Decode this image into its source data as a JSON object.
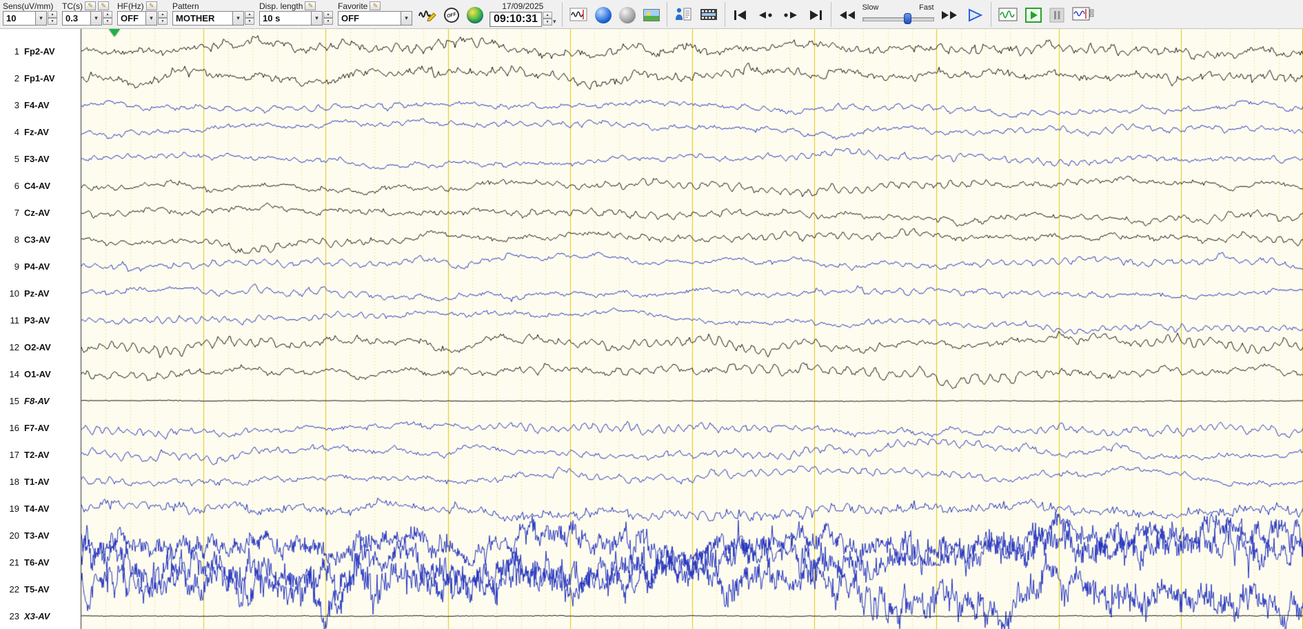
{
  "colors": {
    "trace_black": "#161616",
    "trace_blue": "#2433c0",
    "bg_paper": "#fdfcee",
    "grid_major": "#e3c417",
    "grid_minor": "#eedd8e",
    "marker_green": "#21b24b",
    "accent_blue": "#2f5fd7"
  },
  "icons": {
    "pencil": "✎",
    "caret": "▾",
    "spin_up": "▲",
    "spin_down": "▼"
  },
  "toolbar": {
    "sens": {
      "label": "Sens(uV/mm)",
      "value": "10"
    },
    "tc": {
      "label": "TC(s)",
      "value": "0.3"
    },
    "hf": {
      "label": "HF(Hz)",
      "value": "OFF"
    },
    "pattern": {
      "label": "Pattern",
      "value": "MOTHER"
    },
    "disp_length": {
      "label": "Disp. length",
      "value": "10 s"
    },
    "favorite": {
      "label": "Favorite",
      "value": "OFF"
    },
    "off_stamp": "OFF",
    "date": "17/09/2025",
    "time": "09:10:31",
    "speed": {
      "slow": "Slow",
      "fast": "Fast"
    }
  },
  "display": {
    "seconds": 10
  },
  "channels": [
    {
      "num": "1",
      "label": "Fp2-AV",
      "color": "black",
      "profile": "frontal",
      "italic": false
    },
    {
      "num": "2",
      "label": "Fp1-AV",
      "color": "black",
      "profile": "frontal",
      "italic": false
    },
    {
      "num": "3",
      "label": "F4-AV",
      "color": "blue",
      "profile": "bluemid",
      "italic": false
    },
    {
      "num": "4",
      "label": "Fz-AV",
      "color": "blue",
      "profile": "bluemid",
      "italic": false
    },
    {
      "num": "5",
      "label": "F3-AV",
      "color": "blue",
      "profile": "bluemid",
      "italic": false
    },
    {
      "num": "6",
      "label": "C4-AV",
      "color": "black",
      "profile": "central",
      "italic": false
    },
    {
      "num": "7",
      "label": "Cz-AV",
      "color": "black",
      "profile": "central",
      "italic": false
    },
    {
      "num": "8",
      "label": "C3-AV",
      "color": "black",
      "profile": "central",
      "italic": false
    },
    {
      "num": "9",
      "label": "P4-AV",
      "color": "blue",
      "profile": "bluemid",
      "italic": false
    },
    {
      "num": "10",
      "label": "Pz-AV",
      "color": "blue",
      "profile": "bluemid",
      "italic": false
    },
    {
      "num": "11",
      "label": "P3-AV",
      "color": "blue",
      "profile": "bluemid",
      "italic": false
    },
    {
      "num": "12",
      "label": "O2-AV",
      "color": "black",
      "profile": "occ",
      "italic": false
    },
    {
      "num": "14",
      "label": "O1-AV",
      "color": "black",
      "profile": "occ",
      "italic": false
    },
    {
      "num": "15",
      "label": "F8-AV",
      "color": "black",
      "profile": "flat",
      "italic": true
    },
    {
      "num": "16",
      "label": "F7-AV",
      "color": "blue",
      "profile": "temporal",
      "italic": false
    },
    {
      "num": "17",
      "label": "T2-AV",
      "color": "blue",
      "profile": "temporal",
      "italic": false
    },
    {
      "num": "18",
      "label": "T1-AV",
      "color": "blue",
      "profile": "temporal",
      "italic": false
    },
    {
      "num": "19",
      "label": "T4-AV",
      "color": "blue",
      "profile": "t4",
      "italic": false
    },
    {
      "num": "20",
      "label": "T3-AV",
      "color": "blue",
      "profile": "noisy",
      "italic": false
    },
    {
      "num": "21",
      "label": "T6-AV",
      "color": "blue",
      "profile": "vnoisy",
      "italic": false
    },
    {
      "num": "22",
      "label": "T5-AV",
      "color": "blue",
      "profile": "vnoisy",
      "italic": false
    },
    {
      "num": "23",
      "label": "X3-AV",
      "color": "black",
      "profile": "flat",
      "italic": true
    }
  ]
}
